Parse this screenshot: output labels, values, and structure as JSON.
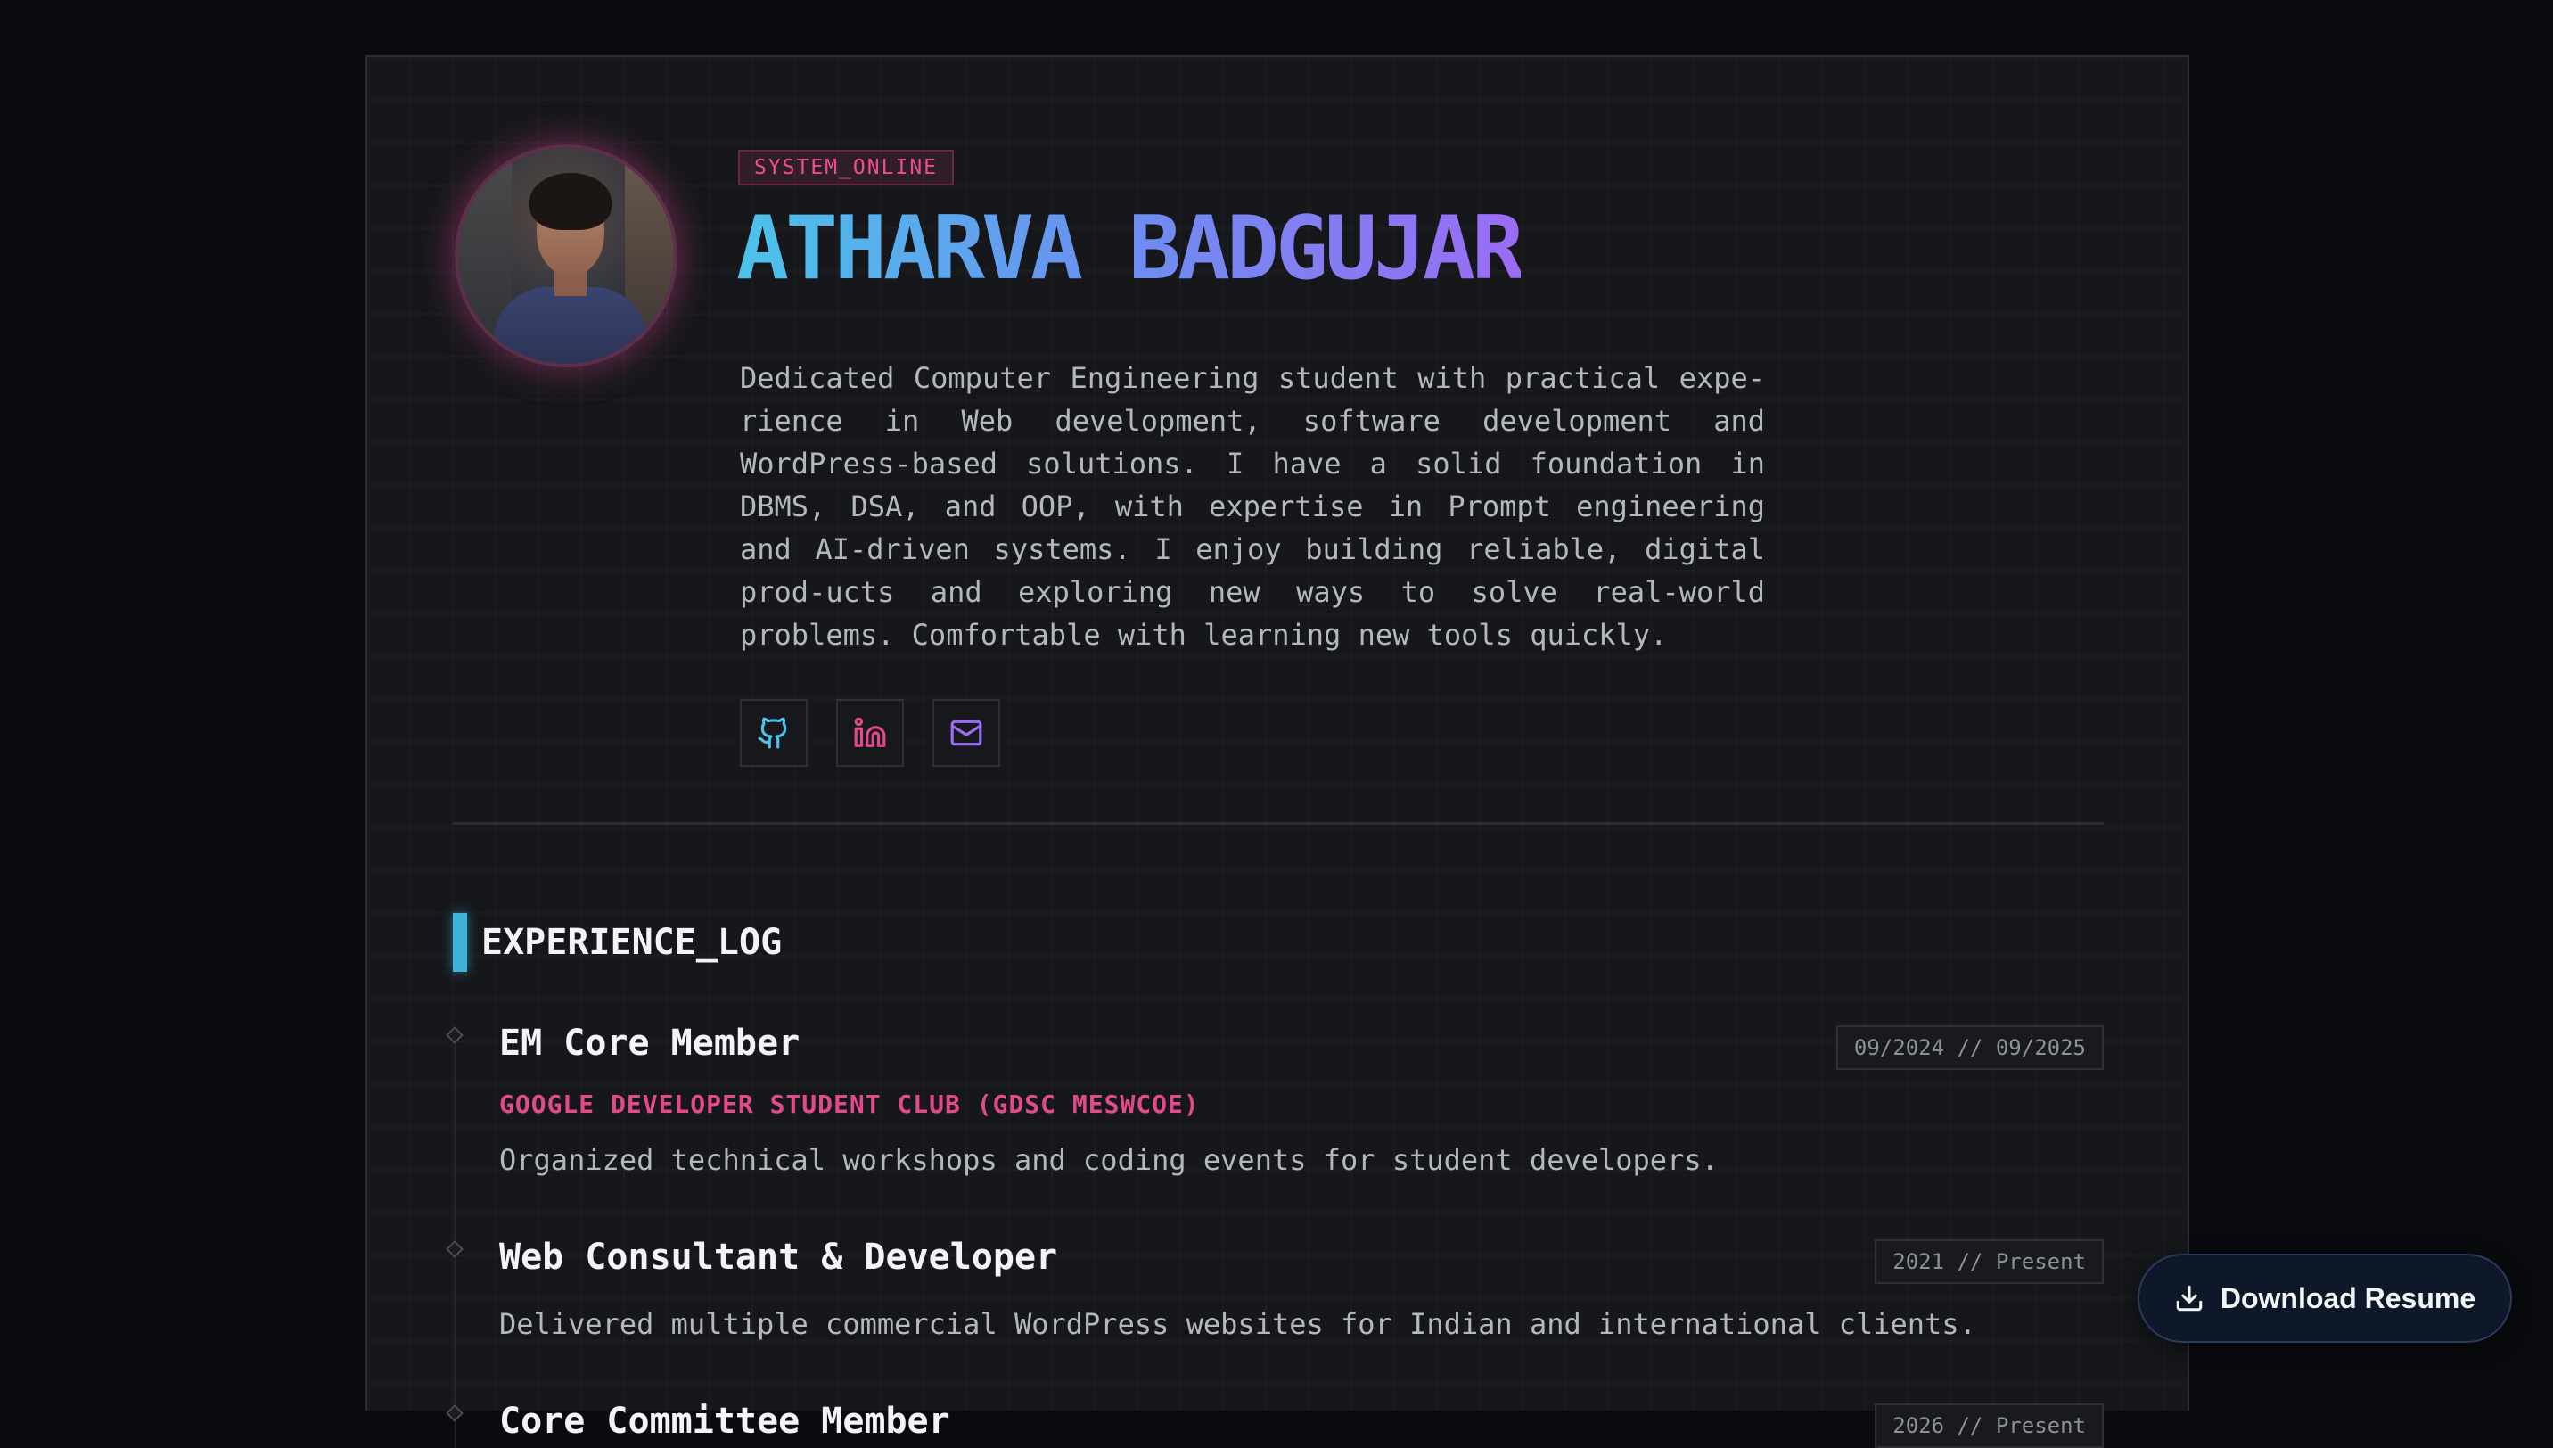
{
  "profile": {
    "status_tag": "SYSTEM_ONLINE",
    "name": "ATHARVA BADGUJAR",
    "bio": "Dedicated Computer Engineering student with practical expe-rience in Web development, software development and WordPress-based solutions. I have a solid foundation in DBMS, DSA, and OOP, with expertise in Prompt engineering and AI-driven systems. I enjoy building reliable, digital prod-ucts and exploring new ways to solve real-world problems. Comfortable with learning new tools quickly."
  },
  "socials": [
    {
      "icon": "github-icon",
      "color": "#4cc3e9"
    },
    {
      "icon": "linkedin-icon",
      "color": "#e24a8b"
    },
    {
      "icon": "mail-icon",
      "color": "#9b6cf4"
    }
  ],
  "experience": {
    "section_title": "EXPERIENCE_LOG",
    "items": [
      {
        "title": "EM Core Member",
        "date": "09/2024 // 09/2025",
        "org": "GOOGLE DEVELOPER STUDENT CLUB (GDSC MESWCOE)",
        "description": "Organized technical workshops and coding events for student developers."
      },
      {
        "title": "Web Consultant & Developer",
        "date": "2021 // Present",
        "description": "Delivered multiple commercial WordPress websites for Indian and international clients."
      },
      {
        "title": "Core Committee Member",
        "date": "2026 // Present"
      }
    ]
  },
  "actions": {
    "download_resume": "Download Resume"
  },
  "colors": {
    "accent_cyan": "#3fb3d8",
    "accent_pink": "#e24a8b",
    "accent_purple": "#9b6cf4"
  }
}
